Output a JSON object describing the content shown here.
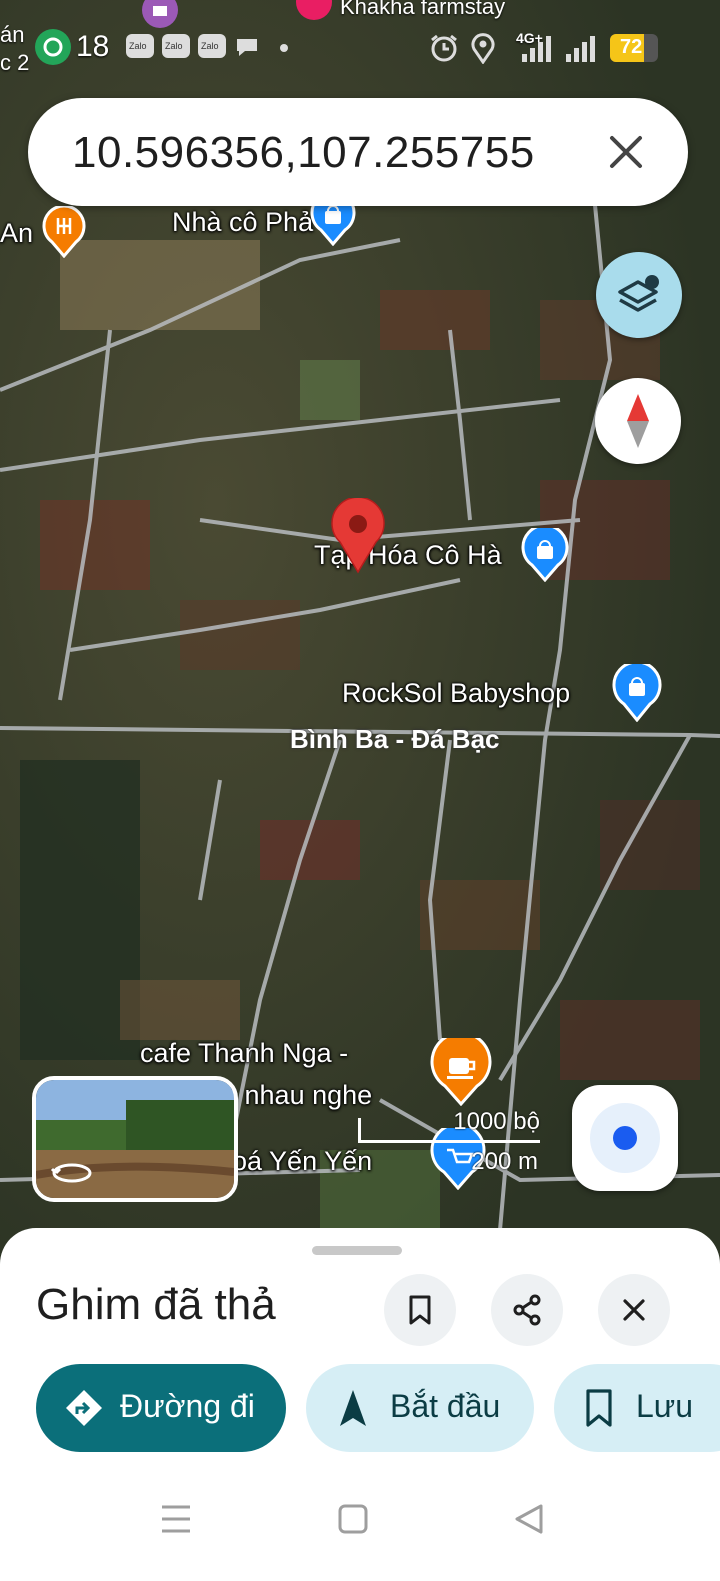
{
  "status_bar": {
    "time": "18",
    "notif_badges": [
      "Zalo",
      "Zalo",
      "Zalo"
    ],
    "network": "4G+",
    "battery": "72",
    "top_poi_label": "Khakha farmstay",
    "left_edge_text_1": "án",
    "left_edge_text_2": "c 2"
  },
  "search": {
    "query": "10.596356,107.255755"
  },
  "map": {
    "poi_labels": {
      "an": "An",
      "nha_co_pha": "Nhà cô Phả",
      "tap_hoa": "Tạp Hóa Cô Hà",
      "rocksol": "RockSol Babyshop",
      "cafe_1": "cafe Thanh Nga -",
      "cafe_2": "o nhau nghe",
      "yen": "oá Yến Yến"
    },
    "road_label": "Bình Ba - Đá Bạc",
    "scale": {
      "feet": "1000 bộ",
      "meters": "200 m"
    }
  },
  "sheet": {
    "title": "Ghim đã thả",
    "actions": {
      "directions": "Đường đi",
      "start": "Bắt đầu",
      "save": "Lưu"
    }
  },
  "colors": {
    "primary": "#0b6f7a",
    "secondary_pill": "#d6eef5",
    "pin_red": "#e53935",
    "poi_blue": "#1a8cff",
    "poi_orange": "#f57c00"
  },
  "icons": {
    "layers": "layers-icon",
    "compass": "compass-icon",
    "my_location": "my-location-icon",
    "bookmark": "bookmark-icon",
    "share": "share-icon",
    "close": "close-icon"
  }
}
